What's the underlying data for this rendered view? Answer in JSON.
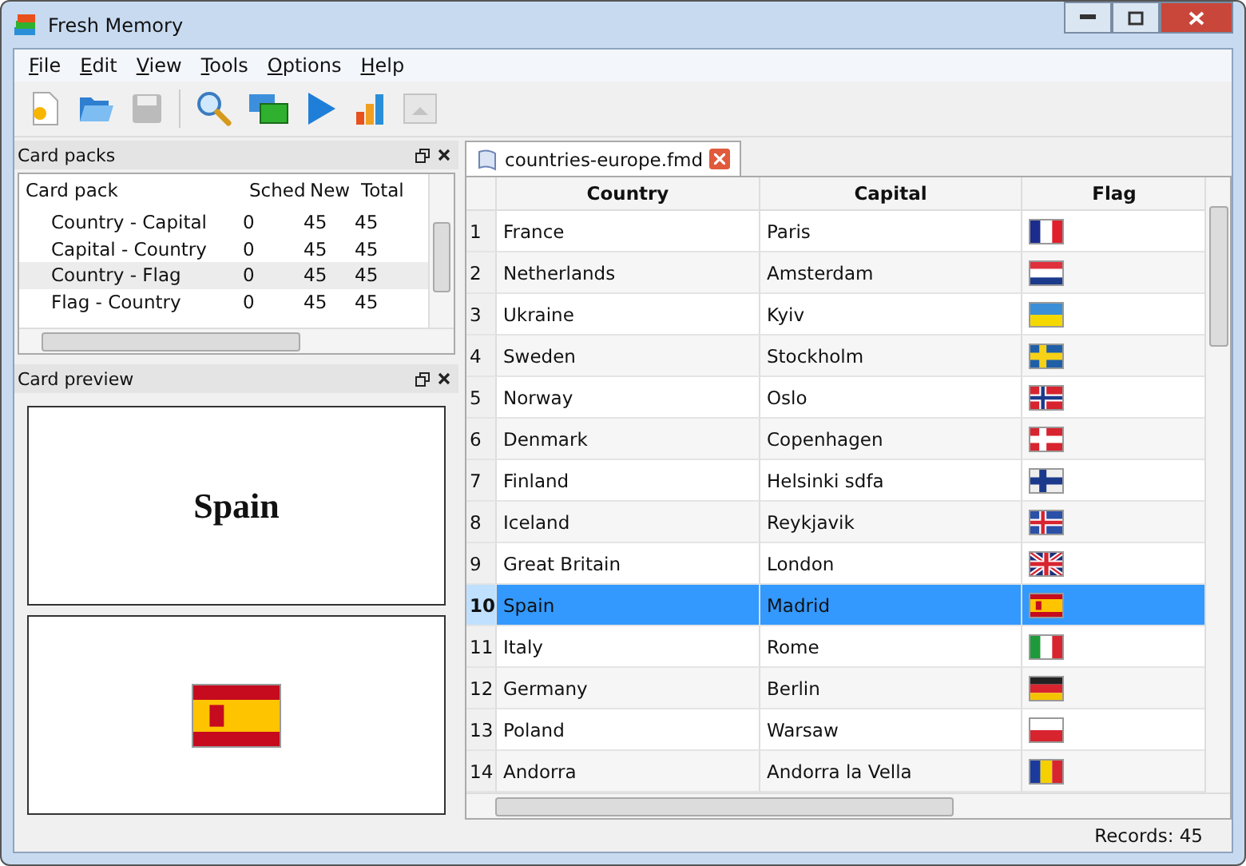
{
  "window": {
    "title": "Fresh Memory"
  },
  "menu": [
    {
      "label": "File"
    },
    {
      "label": "Edit"
    },
    {
      "label": "View"
    },
    {
      "label": "Tools"
    },
    {
      "label": "Options"
    },
    {
      "label": "Help"
    }
  ],
  "toolbar": [
    {
      "kind": "new",
      "disabled": false
    },
    {
      "kind": "open",
      "disabled": false
    },
    {
      "kind": "save",
      "disabled": false
    },
    {
      "kind": "sep",
      "disabled": false
    },
    {
      "kind": "search",
      "disabled": false
    },
    {
      "kind": "windows",
      "disabled": false
    },
    {
      "kind": "play",
      "disabled": false
    },
    {
      "kind": "chart",
      "disabled": false
    },
    {
      "kind": "picture",
      "disabled": true
    }
  ],
  "card_packs": {
    "title": "Card packs",
    "columns": [
      "Card pack",
      "Sched",
      "New",
      "Total"
    ],
    "rows": [
      {
        "name": "Country - Capital",
        "sched": "0",
        "new": "45",
        "total": "45",
        "selected": false
      },
      {
        "name": "Capital - Country",
        "sched": "0",
        "new": "45",
        "total": "45",
        "selected": false
      },
      {
        "name": "Country - Flag",
        "sched": "0",
        "new": "45",
        "total": "45",
        "selected": true
      },
      {
        "name": "Flag - Country",
        "sched": "0",
        "new": "45",
        "total": "45",
        "selected": false
      }
    ]
  },
  "card_preview": {
    "title": "Card preview",
    "front": "Spain",
    "back_flag": {
      "kind": "spain",
      "stripes": [
        {
          "color": "#c60b1e"
        },
        {
          "color": "#ffc400"
        }
      ]
    }
  },
  "tab": {
    "label": "countries-europe.fmd"
  },
  "table": {
    "columns": [
      "Country",
      "Capital",
      "Flag"
    ],
    "rows": [
      {
        "num": "1",
        "country": "France",
        "capital": "Paris",
        "selected": false,
        "flag": {
          "kind": "v3",
          "stripes": [
            {
              "color": "#1b2c8c"
            },
            {
              "color": "#ffffff"
            },
            {
              "color": "#e0202c"
            }
          ]
        }
      },
      {
        "num": "2",
        "country": "Netherlands",
        "capital": "Amsterdam",
        "selected": false,
        "flag": {
          "kind": "h3",
          "stripes": [
            {
              "color": "#e0303c"
            },
            {
              "color": "#ffffff"
            },
            {
              "color": "#1c3a8c"
            }
          ]
        }
      },
      {
        "num": "3",
        "country": "Ukraine",
        "capital": "Kyiv",
        "selected": false,
        "flag": {
          "kind": "h2",
          "stripes": [
            {
              "color": "#3b8fd6"
            },
            {
              "color": "#f5d800"
            }
          ]
        }
      },
      {
        "num": "4",
        "country": "Sweden",
        "capital": "Stockholm",
        "selected": false,
        "flag": {
          "kind": "nordic",
          "stripes": [
            {
              "color": "#1f5fa8"
            },
            {
              "color": "#f7d117"
            }
          ]
        }
      },
      {
        "num": "5",
        "country": "Norway",
        "capital": "Oslo",
        "selected": false,
        "flag": {
          "kind": "nordic",
          "stripes": [
            {
              "color": "#d7242f"
            },
            {
              "color": "#ffffff"
            },
            {
              "color": "#1c3a8c"
            }
          ]
        }
      },
      {
        "num": "6",
        "country": "Denmark",
        "capital": "Copenhagen",
        "selected": false,
        "flag": {
          "kind": "nordic",
          "stripes": [
            {
              "color": "#d7242f"
            },
            {
              "color": "#ffffff"
            }
          ]
        }
      },
      {
        "num": "7",
        "country": "Finland",
        "capital": "Helsinki sdfa",
        "selected": false,
        "flag": {
          "kind": "nordic",
          "stripes": [
            {
              "color": "#eeeeee"
            },
            {
              "color": "#1c3a8c"
            }
          ]
        }
      },
      {
        "num": "8",
        "country": "Iceland",
        "capital": "Reykjavik",
        "selected": false,
        "flag": {
          "kind": "nordic",
          "stripes": [
            {
              "color": "#2a50a8"
            },
            {
              "color": "#ffffff"
            },
            {
              "color": "#d7242f"
            }
          ]
        }
      },
      {
        "num": "9",
        "country": "Great Britain",
        "capital": "London",
        "selected": false,
        "flag": {
          "kind": "union",
          "stripes": [
            {
              "color": "#1c2f7a"
            },
            {
              "color": "#ffffff"
            },
            {
              "color": "#d7242f"
            }
          ]
        }
      },
      {
        "num": "10",
        "country": "Spain",
        "capital": "Madrid",
        "selected": true,
        "flag": {
          "kind": "spain",
          "stripes": [
            {
              "color": "#c60b1e"
            },
            {
              "color": "#ffc400"
            }
          ]
        }
      },
      {
        "num": "11",
        "country": "Italy",
        "capital": "Rome",
        "selected": false,
        "flag": {
          "kind": "v3",
          "stripes": [
            {
              "color": "#1f9a3a"
            },
            {
              "color": "#ffffff"
            },
            {
              "color": "#d7242f"
            }
          ]
        }
      },
      {
        "num": "12",
        "country": "Germany",
        "capital": "Berlin",
        "selected": false,
        "flag": {
          "kind": "h3",
          "stripes": [
            {
              "color": "#222222"
            },
            {
              "color": "#d7242f"
            },
            {
              "color": "#f5c400"
            }
          ]
        }
      },
      {
        "num": "13",
        "country": "Poland",
        "capital": "Warsaw",
        "selected": false,
        "flag": {
          "kind": "h2",
          "stripes": [
            {
              "color": "#ffffff"
            },
            {
              "color": "#d7242f"
            }
          ]
        }
      },
      {
        "num": "14",
        "country": "Andorra",
        "capital": "Andorra la Vella",
        "selected": false,
        "flag": {
          "kind": "v3",
          "stripes": [
            {
              "color": "#1a3a9c"
            },
            {
              "color": "#f5d000"
            },
            {
              "color": "#d7242f"
            }
          ]
        }
      }
    ]
  },
  "status_bar": {
    "records": "Records: 45"
  }
}
